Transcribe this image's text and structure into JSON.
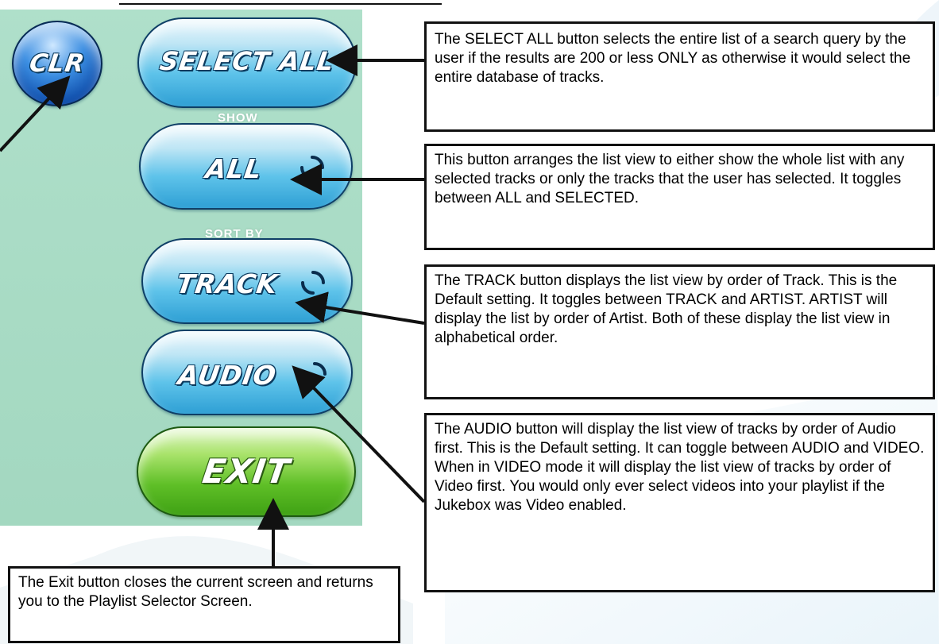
{
  "buttons": {
    "clear": "CLR",
    "select_all": "SELECT ALL",
    "show_caption": "SHOW",
    "show": "ALL",
    "sort_caption": "SORT BY",
    "sort": "TRACK",
    "media": "AUDIO",
    "exit": "EXIT"
  },
  "descriptions": {
    "select_all": "The SELECT ALL button selects the entire list of a search query by the user if the results are 200 or less ONLY as otherwise it would select the entire database of tracks.",
    "show": "This button arranges the list view to either show the whole list with any selected tracks or only the tracks that the user has selected. It toggles between ALL and SELECTED.",
    "sort": "The TRACK button displays the list view by order of Track. This is the Default setting. It toggles between TRACK and ARTIST. ARTIST will display the list by order of Artist. Both of these display the list view in alphabetical order.",
    "media": "The AUDIO button will display the list view of tracks by order of Audio first. This is the Default setting. It can toggle between AUDIO and VIDEO. When in VIDEO mode it will display the list view of tracks by order of Video first. You would only ever select videos into your playlist if the Jukebox was Video enabled.",
    "exit": "The Exit button closes the current screen and returns you to the Playlist Selector Screen."
  },
  "icons": {
    "cycle": "cycle-icon"
  },
  "colors": {
    "panel": "#a6dcc4",
    "blue_button": "#5ec3ea",
    "green_button": "#5fbf27",
    "clear_button": "#0d4aa8",
    "box_border": "#111111"
  }
}
